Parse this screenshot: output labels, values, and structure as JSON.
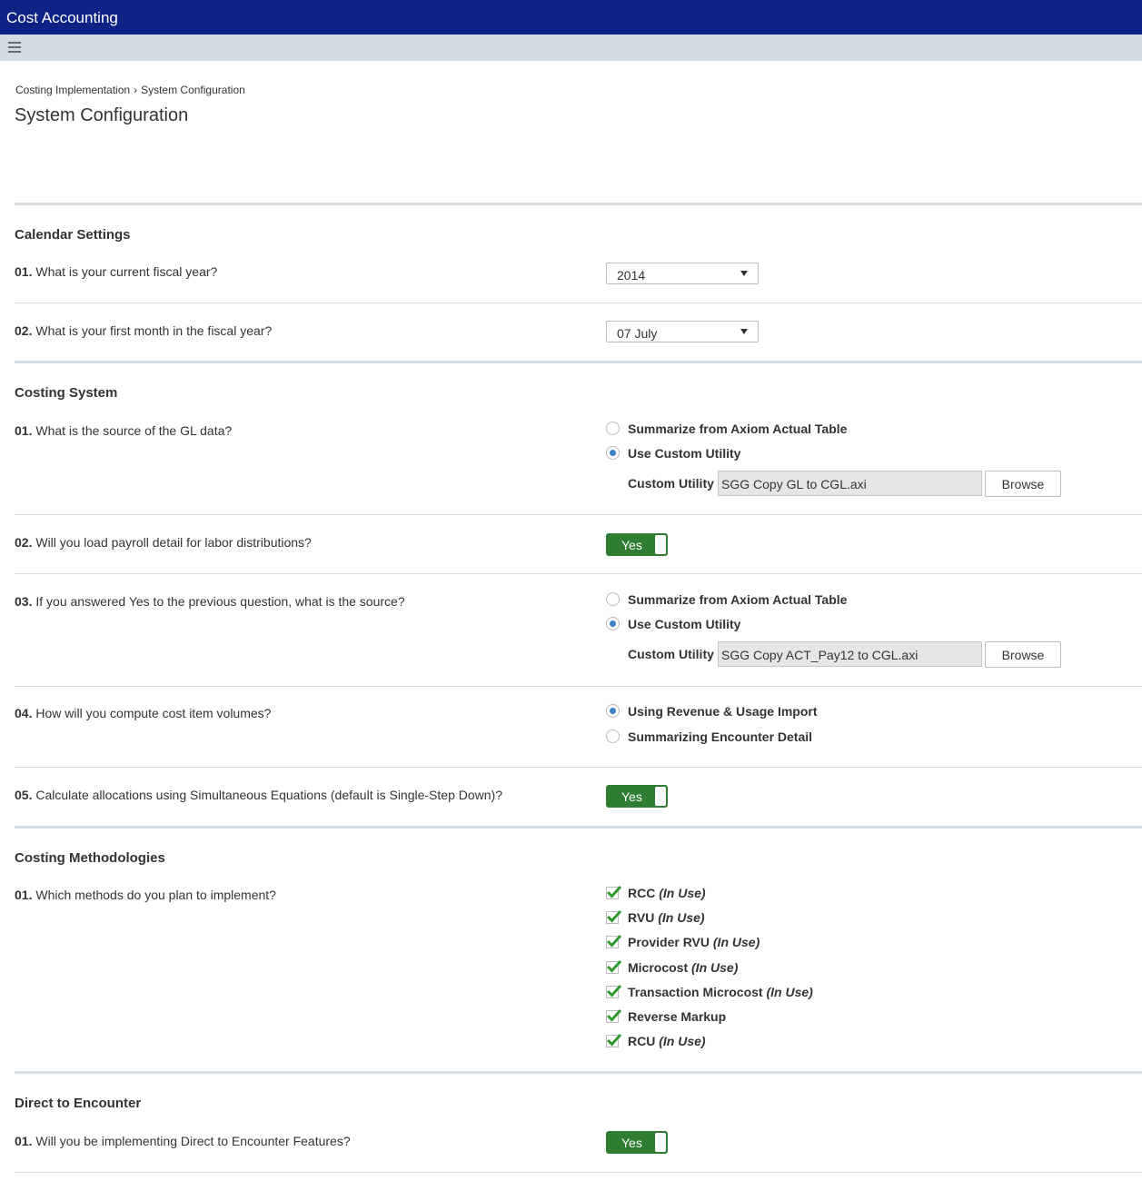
{
  "app": {
    "title": "Cost Accounting"
  },
  "breadcrumb": {
    "parent": "Costing Implementation",
    "separator": "›",
    "current": "System Configuration"
  },
  "page_title": "System Configuration",
  "calendar": {
    "title": "Calendar Settings",
    "q1": {
      "num": "01.",
      "text": "What is your current fiscal year?",
      "value": "2014"
    },
    "q2": {
      "num": "02.",
      "text": "What is your first month in the fiscal year?",
      "value": "07 July"
    }
  },
  "costing": {
    "title": "Costing System",
    "q1": {
      "num": "01.",
      "text": "What is the source of the GL data?",
      "opt1": "Summarize from Axiom Actual Table",
      "opt2": "Use Custom Utility",
      "utility_label": "Custom Utility",
      "utility_value": "SGG Copy GL to CGL.axi",
      "browse": "Browse"
    },
    "q2": {
      "num": "02.",
      "text": "Will you load payroll detail for labor distributions?",
      "toggle": "Yes"
    },
    "q3": {
      "num": "03.",
      "text": "If you answered Yes to the previous question, what is the source?",
      "opt1": "Summarize from Axiom Actual Table",
      "opt2": "Use Custom Utility",
      "utility_label": "Custom Utility",
      "utility_value": "SGG Copy ACT_Pay12 to CGL.axi",
      "browse": "Browse"
    },
    "q4": {
      "num": "04.",
      "text": "How will you compute cost item volumes?",
      "opt1": "Using Revenue & Usage Import",
      "opt2": "Summarizing Encounter Detail"
    },
    "q5": {
      "num": "05.",
      "text": "Calculate allocations using Simultaneous Equations (default is Single-Step Down)?",
      "toggle": "Yes"
    }
  },
  "methodologies": {
    "title": "Costing Methodologies",
    "q1": {
      "num": "01.",
      "text": "Which methods do you plan to implement?"
    },
    "in_use": "(In Use)",
    "methods": [
      {
        "name": "RCC"
      },
      {
        "name": "RVU"
      },
      {
        "name": "Provider RVU"
      },
      {
        "name": "Microcost"
      },
      {
        "name": "Transaction Microcost"
      },
      {
        "name": "Reverse Markup"
      },
      {
        "name": "RCU"
      }
    ]
  },
  "direct": {
    "title": "Direct to Encounter",
    "q1": {
      "num": "01.",
      "text": "Will you be implementing Direct to Encounter Features?",
      "toggle": "Yes"
    }
  },
  "colors": {
    "titlebar": "#0d2284",
    "toolbar": "#d4dbe3",
    "toggle_on": "#2e7d32",
    "radio_on": "#3b7fc4",
    "check": "#2e9a2e"
  },
  "icons": {
    "menu": "hamburger-icon",
    "dropdown": "triangle-down-icon",
    "check": "checkmark-icon"
  }
}
